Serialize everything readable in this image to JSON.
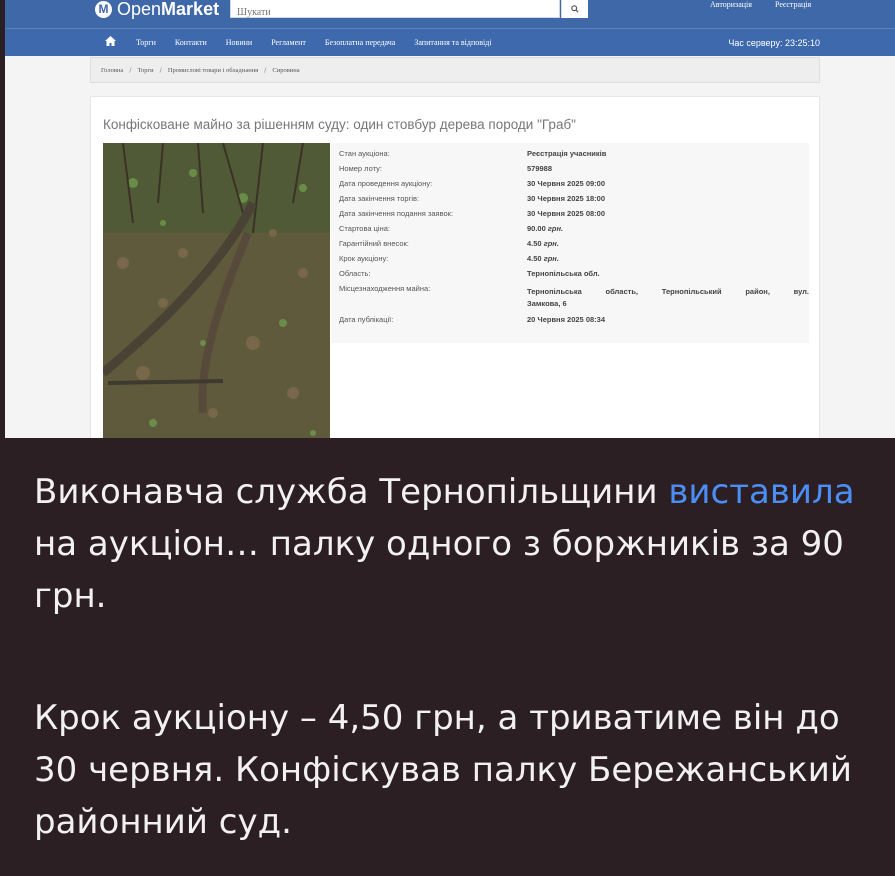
{
  "site": {
    "logo_light": "Open",
    "logo_bold": "Market",
    "search_placeholder": "Шукати",
    "login": "Авторизація",
    "register": "Реєстрація"
  },
  "nav": {
    "items": [
      "Торги",
      "Контакти",
      "Новини",
      "Регламент",
      "Безоплатна передача",
      "Запитання та відповіді"
    ],
    "server_time": "Час серверу: 23:25:10"
  },
  "breadcrumb": [
    "Головна",
    "Торги",
    "Промислові товари і обладнання",
    "Сировина"
  ],
  "lot": {
    "title": "Конфісковане майно за рішенням суду: один стовбур дерева породи \"Граб\"",
    "rows": [
      {
        "label": "Стан аукціона:",
        "value": "Реєстрація учасників"
      },
      {
        "label": "Номер лоту:",
        "value": "579988"
      },
      {
        "label": "Дата проведення аукціону:",
        "value": "30 Червня 2025 09:00"
      },
      {
        "label": "Дата закінчення торгів:",
        "value": "30 Червня 2025 18:00"
      },
      {
        "label": "Дата закінчення подання заявок:",
        "value": "30 Червня 2025 08:00"
      },
      {
        "label": "Стартова ціна:",
        "value": "90.00",
        "unit": "грн."
      },
      {
        "label": "Гарантійний внесок:",
        "value": "4.50",
        "unit": "грн."
      },
      {
        "label": "Крок аукціону:",
        "value": "4.50",
        "unit": "грн."
      },
      {
        "label": "Область:",
        "value": "Тернопільська обл."
      }
    ],
    "location_label": "Місцезнаходження майна:",
    "location_value_line1": "Тернопільська область, Тернопільський район, вул.",
    "location_value_line2": "Замкова, 6",
    "published_label": "Дата публікації:",
    "published_value": "20 Червня 2025 08:34"
  },
  "caption": {
    "p1_before": "Виконавча служба Тернопільщини",
    "p1_link": "виставила",
    "p1_after": "на аукціон… палку одного з боржників за 90 грн.",
    "p2": "Крок аукціону – 4,50 грн, а триватиме він до 30 червня. Конфіскував палку Бережанський районний суд."
  },
  "colors": {
    "navbar": "#3f68a8",
    "link": "#4b8ef5",
    "caption_bg": "#2b1f24"
  }
}
